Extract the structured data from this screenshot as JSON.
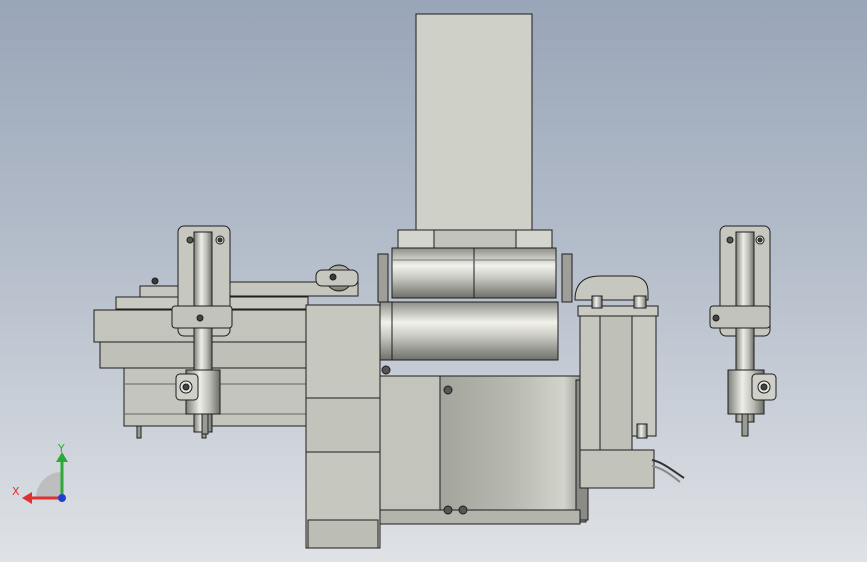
{
  "viewport": {
    "view_orientation": "front",
    "background": [
      "#99a5b8",
      "#b4bdca",
      "#dfe2e6"
    ]
  },
  "model": {
    "description_visible": false,
    "part_color": "#c8c9c0",
    "edge_color": "#1e1e1e",
    "parts": [
      "motor-housing",
      "gearbox",
      "upper-column",
      "rotary-flange",
      "left-clamp-assembly",
      "right-clamp-assembly",
      "left-base-frame",
      "right-bracket",
      "cable"
    ]
  },
  "triad": {
    "x_label": "X",
    "y_label": "Y",
    "x_color": "#e03030",
    "y_color": "#2fa83a",
    "z_color": "#2040d0"
  }
}
